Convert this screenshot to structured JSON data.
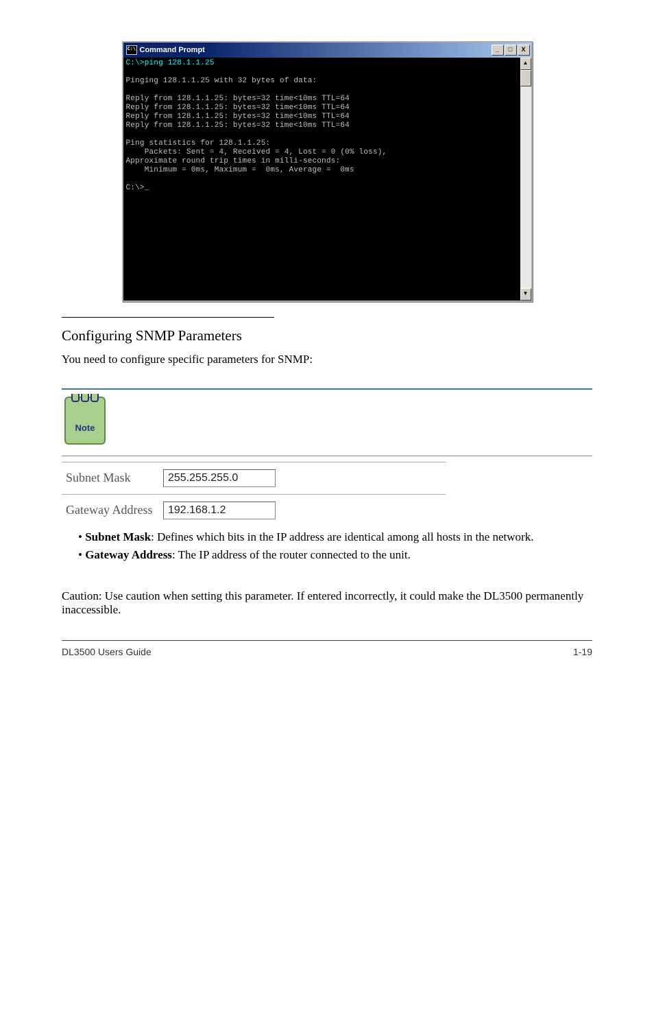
{
  "cmd_window": {
    "title": "Command Prompt",
    "minimize": "_",
    "maximize": "□",
    "close": "X",
    "scroll_up": "▲",
    "scroll_down": "▼",
    "lines": {
      "l0": "C:\\>ping 128.1.1.25",
      "l1": "",
      "l2": "Pinging 128.1.1.25 with 32 bytes of data:",
      "l3": "",
      "l4": "Reply from 128.1.1.25: bytes=32 time<10ms TTL=64",
      "l5": "Reply from 128.1.1.25: bytes=32 time<10ms TTL=64",
      "l6": "Reply from 128.1.1.25: bytes=32 time<10ms TTL=64",
      "l7": "Reply from 128.1.1.25: bytes=32 time<10ms TTL=64",
      "l8": "",
      "l9": "Ping statistics for 128.1.1.25:",
      "l10": "    Packets: Sent = 4, Received = 4, Lost = 0 (0% loss),",
      "l11": "Approximate round trip times in milli-seconds:",
      "l12": "    Minimum = 0ms, Maximum =  0ms, Average =  0ms",
      "l13": "",
      "l14": "C:\\>_"
    }
  },
  "section": {
    "heading": "Configuring SNMP Parameters",
    "intro": "You need to configure specific parameters for SNMP:",
    "note_label": "Note"
  },
  "form": {
    "subnet_label": "Subnet Mask",
    "subnet_value": "255.255.255.0",
    "gateway_label": "Gateway Address",
    "gateway_value": "192.168.1.2"
  },
  "bullets": {
    "b1_lead": "Subnet Mask",
    "b1_rest": ": Defines which bits in the IP address are identical among all hosts in the network.",
    "b2_lead": "Gateway Address",
    "b2_rest": ": The IP address of the router connected to the unit."
  },
  "caution": {
    "text": "Caution: Use caution when setting this parameter. If entered incorrectly, it could make the DL3500 permanently inaccessible."
  },
  "footer": {
    "left": "DL3500 Users Guide",
    "right": "1-19"
  }
}
